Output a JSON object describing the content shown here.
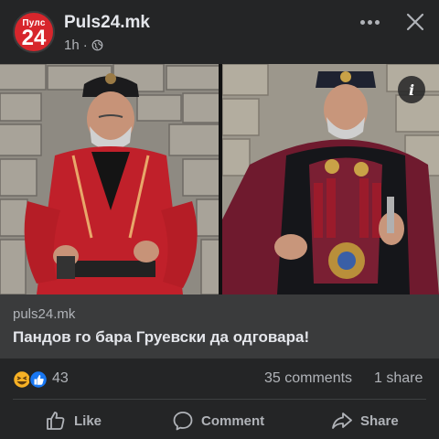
{
  "post": {
    "avatar_top": "Пулс",
    "avatar_num": "24",
    "page_name": "Puls24.mk",
    "time": "1h",
    "separator": "·"
  },
  "media": {
    "left_photo": "man-in-red-traditional-costume",
    "right_photo": "man-in-burgundy-ceremonial-costume"
  },
  "link": {
    "domain": "puls24.mk",
    "headline": "Пандов го бара Груевски да одговара!"
  },
  "stats": {
    "reaction_count": "43",
    "comments": "35 comments",
    "shares": "1 share"
  },
  "actions": {
    "like": "Like",
    "comment": "Comment",
    "share": "Share"
  },
  "colors": {
    "background": "#242526",
    "link_box": "#3a3b3c",
    "brand_red": "#d7262c",
    "like_blue": "#1877f2",
    "haha_yellow": "#f7b125",
    "secondary_text": "#b0b3b8"
  }
}
